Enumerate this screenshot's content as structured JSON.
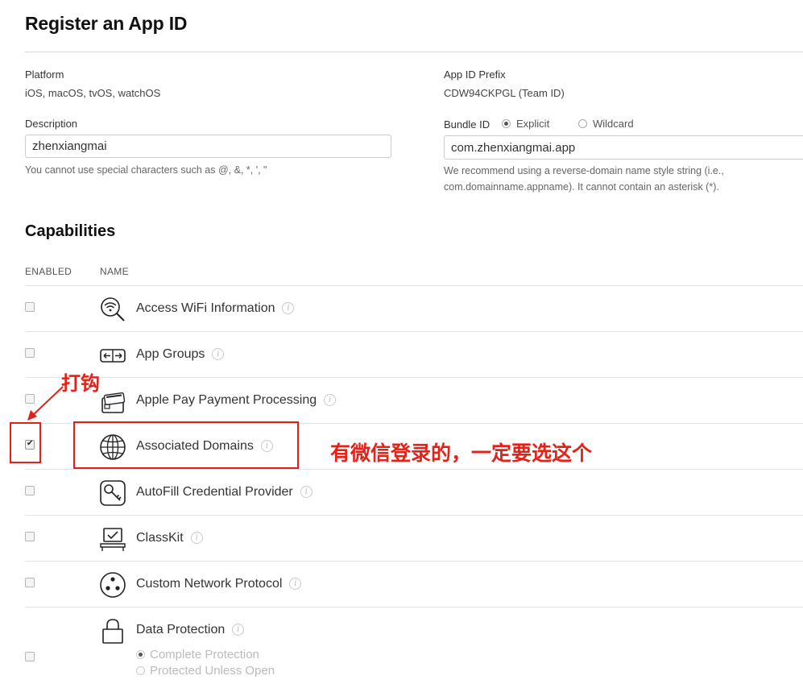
{
  "page": {
    "title": "Register an App ID"
  },
  "platform": {
    "label": "Platform",
    "value": "iOS, macOS, tvOS, watchOS"
  },
  "prefix": {
    "label": "App ID Prefix",
    "value": "CDW94CKPGL (Team ID)"
  },
  "description": {
    "label": "Description",
    "value": "zhenxiangmai",
    "hint": "You cannot use special characters such as @, &, *, ', \""
  },
  "bundle": {
    "label": "Bundle ID",
    "explicit_label": "Explicit",
    "wildcard_label": "Wildcard",
    "selected": "Explicit",
    "value": "com.zhenxiangmai.app",
    "hint_line1": "We recommend using a reverse-domain name style string (i.e.,",
    "hint_line2": "com.domainname.appname). It cannot contain an asterisk (*)."
  },
  "capabilities": {
    "title": "Capabilities",
    "col_enabled": "ENABLED",
    "col_name": "NAME",
    "items": [
      {
        "name": "Access WiFi Information",
        "icon": "wifi-search-icon",
        "enabled": false
      },
      {
        "name": "App Groups",
        "icon": "app-groups-icon",
        "enabled": false
      },
      {
        "name": "Apple Pay Payment Processing",
        "icon": "wallet-icon",
        "enabled": false
      },
      {
        "name": "Associated Domains",
        "icon": "globe-icon",
        "enabled": true
      },
      {
        "name": "AutoFill Credential Provider",
        "icon": "key-icon",
        "enabled": false
      },
      {
        "name": "ClassKit",
        "icon": "classkit-icon",
        "enabled": false
      },
      {
        "name": "Custom Network Protocol",
        "icon": "network-icon",
        "enabled": false
      },
      {
        "name": "Data Protection",
        "icon": "lock-icon",
        "enabled": false
      }
    ],
    "data_protection_options": [
      "Complete Protection",
      "Protected Unless Open"
    ]
  },
  "annotations": {
    "check_note": "打钩",
    "domains_note": "有微信登录的，一定要选这个",
    "color": "#e0201a"
  }
}
